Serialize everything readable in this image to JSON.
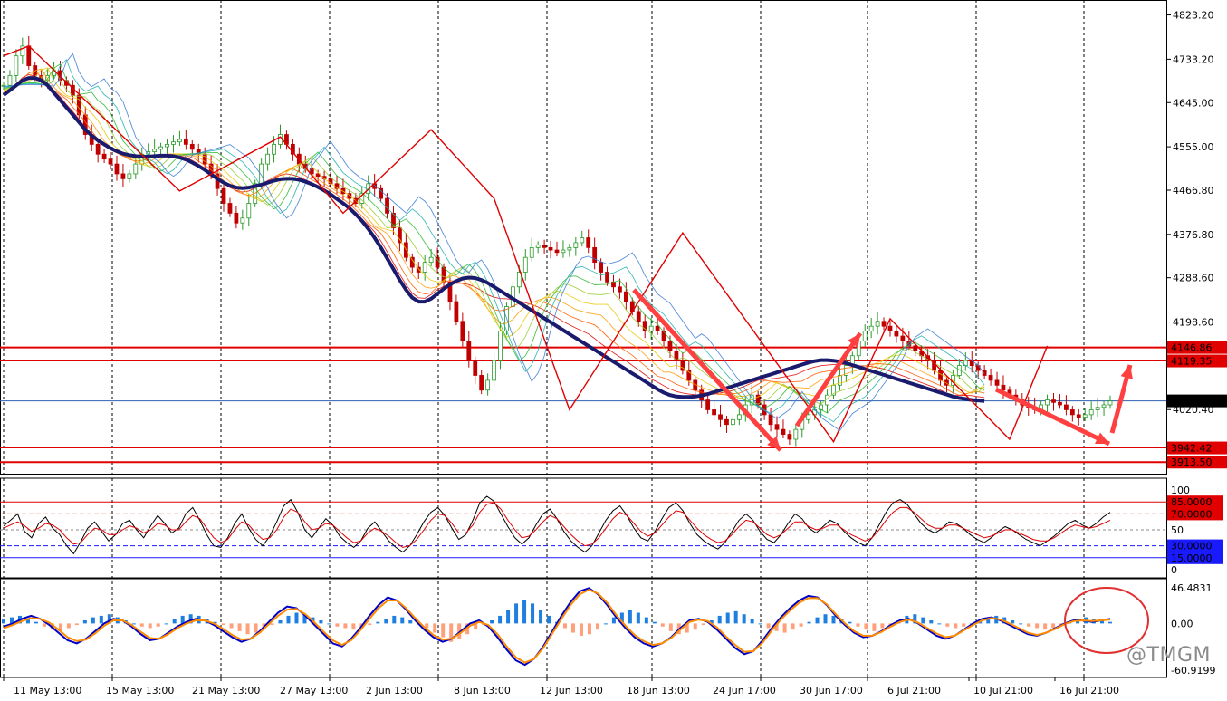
{
  "watermark": "@TMGM",
  "chart_data": [
    {
      "type": "candlestick",
      "panel": "price",
      "ylim": [
        3890,
        4850
      ],
      "ticks": [
        "4823.20",
        "4733.20",
        "4645.00",
        "4555.00",
        "4466.80",
        "4376.80",
        "4288.60",
        "4198.60",
        "4020.40"
      ],
      "tick_values": [
        4823.2,
        4733.2,
        4645.0,
        4555.0,
        4466.8,
        4376.8,
        4288.6,
        4198.6,
        4020.4
      ],
      "current_price": {
        "label": "4038.14",
        "value": 4038.14,
        "color": "#2f5fb0"
      },
      "levels": [
        {
          "label": "4146.86",
          "value": 4146.86,
          "color": "#e00000"
        },
        {
          "label": "4119.35",
          "value": 4119.35,
          "color": "#e00000"
        },
        {
          "label": "3942.42",
          "value": 3942.42,
          "color": "#e00000"
        },
        {
          "label": "3913.50",
          "value": 3913.5,
          "color": "#e00000"
        }
      ],
      "x_labels": [
        "11 May 13:00",
        "15 May 13:00",
        "21 May 13:00",
        "27 May 13:00",
        "2 Jun 13:00",
        "8 Jun 13:00",
        "12 Jun 13:00",
        "18 Jun 13:00",
        "24 Jun 17:00",
        "30 Jun 17:00",
        "6 Jul 21:00",
        "10 Jul 21:00",
        "16 Jul 21:00"
      ],
      "close_series": [
        4680,
        4700,
        4740,
        4760,
        4720,
        4700,
        4690,
        4700,
        4710,
        4690,
        4680,
        4660,
        4620,
        4580,
        4560,
        4540,
        4530,
        4520,
        4500,
        4490,
        4500,
        4520,
        4540,
        4545,
        4550,
        4555,
        4560,
        4565,
        4570,
        4560,
        4550,
        4540,
        4520,
        4500,
        4470,
        4440,
        4420,
        4400,
        4410,
        4440,
        4480,
        4520,
        4540,
        4560,
        4580,
        4560,
        4540,
        4520,
        4510,
        4500,
        4495,
        4490,
        4480,
        4470,
        4460,
        4450,
        4440,
        4460,
        4480,
        4470,
        4450,
        4420,
        4390,
        4360,
        4330,
        4310,
        4300,
        4320,
        4330,
        4310,
        4280,
        4240,
        4200,
        4160,
        4120,
        4090,
        4060,
        4080,
        4120,
        4180,
        4230,
        4270,
        4300,
        4330,
        4350,
        4355,
        4350,
        4345,
        4340,
        4345,
        4350,
        4360,
        4370,
        4350,
        4320,
        4300,
        4280,
        4270,
        4260,
        4240,
        4220,
        4200,
        4180,
        4190,
        4180,
        4160,
        4140,
        4120,
        4100,
        4080,
        4060,
        4040,
        4020,
        4010,
        4000,
        3990,
        4000,
        4010,
        4030,
        4050,
        4030,
        4010,
        3990,
        3980,
        3970,
        3960,
        3980,
        4000,
        4010,
        4020,
        4030,
        4050,
        4070,
        4090,
        4110,
        4130,
        4160,
        4180,
        4190,
        4200,
        4190,
        4180,
        4170,
        4160,
        4150,
        4140,
        4130,
        4120,
        4100,
        4080,
        4070,
        4090,
        4110,
        4120,
        4110,
        4100,
        4090,
        4080,
        4070,
        4060,
        4050,
        4040,
        4030,
        4025,
        4020,
        4030,
        4040,
        4035,
        4030,
        4020,
        4010,
        4005,
        4010,
        4020,
        4025,
        4030,
        4038
      ],
      "ma_series": [
        4660,
        4670,
        4680,
        4690,
        4695,
        4695,
        4690,
        4680,
        4665,
        4650,
        4635,
        4620,
        4605,
        4590,
        4578,
        4568,
        4560,
        4552,
        4546,
        4541,
        4538,
        4536,
        4535,
        4535,
        4536,
        4537,
        4537,
        4536,
        4533,
        4529,
        4523,
        4516,
        4508,
        4499,
        4490,
        4482,
        4476,
        4472,
        4471,
        4472,
        4475,
        4478,
        4482,
        4486,
        4489,
        4490,
        4490,
        4488,
        4484,
        4479,
        4473,
        4466,
        4458,
        4449,
        4440,
        4430,
        4418,
        4404,
        4388,
        4370,
        4350,
        4328,
        4306,
        4284,
        4264,
        4248,
        4240,
        4240,
        4246,
        4256,
        4266,
        4275,
        4282,
        4287,
        4289,
        4288,
        4284,
        4278,
        4270,
        4262,
        4254,
        4246,
        4238,
        4230,
        4222,
        4214,
        4206,
        4198,
        4190,
        4182,
        4174,
        4166,
        4158,
        4150,
        4142,
        4134,
        4126,
        4118,
        4110,
        4102,
        4094,
        4086,
        4078,
        4070,
        4062,
        4055,
        4050,
        4047,
        4046,
        4046,
        4047,
        4049,
        4052,
        4056,
        4060,
        4064,
        4068,
        4072,
        4076,
        4080,
        4084,
        4088,
        4092,
        4096,
        4100,
        4104,
        4108,
        4112,
        4116,
        4119,
        4121,
        4121,
        4120,
        4118,
        4115,
        4111,
        4107,
        4103,
        4099,
        4095,
        4091,
        4087,
        4083,
        4079,
        4075,
        4071,
        4067,
        4063,
        4059,
        4055,
        4051,
        4047,
        4044,
        4042,
        4040,
        4039,
        4038
      ]
    },
    {
      "type": "line",
      "panel": "stochastic",
      "ylim": [
        0,
        100
      ],
      "tick_labels": [
        "100",
        "50",
        "0"
      ],
      "levels": [
        {
          "label": "85.0000",
          "value": 85,
          "color": "#e00000"
        },
        {
          "label": "70.0000",
          "value": 70,
          "color": "#e00000"
        },
        {
          "label": "30.0000",
          "value": 30,
          "color": "#1a1aff"
        },
        {
          "label": "15.0000",
          "value": 15,
          "color": "#1a1aff"
        }
      ],
      "series": [
        {
          "color": "#000000",
          "values": [
            55,
            62,
            70,
            48,
            40,
            58,
            66,
            52,
            44,
            30,
            20,
            35,
            52,
            60,
            48,
            36,
            44,
            58,
            62,
            50,
            40,
            55,
            68,
            58,
            46,
            52,
            70,
            78,
            62,
            44,
            30,
            28,
            40,
            58,
            70,
            52,
            38,
            30,
            42,
            60,
            80,
            88,
            72,
            50,
            40,
            52,
            64,
            56,
            42,
            34,
            28,
            36,
            52,
            60,
            48,
            36,
            28,
            22,
            30,
            44,
            60,
            72,
            78,
            68,
            52,
            38,
            44,
            62,
            84,
            92,
            86,
            70,
            54,
            40,
            32,
            40,
            56,
            70,
            76,
            64,
            48,
            36,
            28,
            22,
            30,
            46,
            62,
            74,
            80,
            68,
            52,
            40,
            36,
            48,
            64,
            78,
            84,
            74,
            58,
            44,
            36,
            30,
            26,
            34,
            48,
            62,
            70,
            62,
            48,
            38,
            34,
            44,
            58,
            70,
            64,
            52,
            46,
            54,
            62,
            58,
            48,
            40,
            34,
            30,
            40,
            56,
            72,
            84,
            88,
            82,
            70,
            58,
            50,
            46,
            52,
            60,
            58,
            52,
            44,
            38,
            34,
            40,
            48,
            54,
            50,
            44,
            38,
            34,
            30,
            36,
            42,
            50,
            58,
            62,
            56,
            52,
            58,
            66,
            72
          ]
        },
        {
          "color": "#e00000",
          "values": [
            52,
            56,
            60,
            55,
            48,
            52,
            58,
            56,
            50,
            40,
            32,
            34,
            44,
            52,
            50,
            44,
            44,
            50,
            55,
            52,
            46,
            50,
            58,
            56,
            50,
            50,
            60,
            68,
            64,
            52,
            40,
            34,
            38,
            50,
            60,
            56,
            46,
            38,
            40,
            50,
            66,
            76,
            72,
            60,
            50,
            52,
            58,
            56,
            48,
            40,
            34,
            36,
            46,
            52,
            48,
            42,
            34,
            28,
            30,
            38,
            50,
            62,
            70,
            68,
            58,
            46,
            46,
            56,
            72,
            82,
            84,
            76,
            62,
            50,
            40,
            42,
            50,
            60,
            68,
            64,
            54,
            44,
            36,
            30,
            32,
            40,
            52,
            64,
            72,
            68,
            58,
            48,
            42,
            46,
            56,
            66,
            74,
            72,
            62,
            52,
            44,
            38,
            34,
            36,
            44,
            54,
            62,
            60,
            52,
            44,
            40,
            44,
            52,
            60,
            60,
            54,
            50,
            52,
            56,
            56,
            50,
            44,
            40,
            36,
            40,
            50,
            62,
            72,
            78,
            78,
            72,
            64,
            56,
            52,
            52,
            56,
            56,
            52,
            48,
            44,
            40,
            42,
            46,
            50,
            50,
            46,
            42,
            38,
            36,
            36,
            40,
            46,
            52,
            56,
            54,
            52,
            54,
            58,
            62
          ]
        }
      ]
    },
    {
      "type": "bar+line",
      "panel": "macd",
      "ylim": [
        -60.9199,
        46.4831
      ],
      "tick_labels": [
        "46.4831",
        "0.00",
        "-60.9199"
      ],
      "histogram": [
        5,
        8,
        10,
        6,
        2,
        -4,
        -8,
        -10,
        -6,
        -2,
        4,
        8,
        10,
        12,
        8,
        4,
        0,
        -4,
        -6,
        -4,
        0,
        6,
        10,
        12,
        10,
        6,
        2,
        -2,
        -6,
        -10,
        -14,
        -12,
        -8,
        -2,
        4,
        10,
        14,
        12,
        8,
        4,
        0,
        -4,
        -6,
        -8,
        -6,
        -2,
        2,
        6,
        10,
        8,
        4,
        0,
        -6,
        -12,
        -18,
        -24,
        -20,
        -14,
        -8,
        -2,
        4,
        10,
        18,
        26,
        30,
        26,
        18,
        10,
        2,
        -6,
        -12,
        -16,
        -14,
        -8,
        0,
        8,
        14,
        18,
        14,
        8,
        2,
        -4,
        -10,
        -14,
        -12,
        -8,
        -2,
        4,
        10,
        14,
        16,
        12,
        6,
        0,
        -6,
        -10,
        -12,
        -8,
        -4,
        2,
        8,
        12,
        10,
        6,
        2,
        -4,
        -8,
        -10,
        -6,
        -2,
        4,
        10,
        12,
        8,
        4,
        0,
        -4,
        -6,
        -4,
        0,
        4,
        8,
        10,
        8,
        4,
        0,
        -4,
        -6,
        -8,
        -6,
        -2,
        2,
        6,
        8,
        6,
        4,
        2
      ],
      "series": [
        {
          "color": "#0000c8",
          "values": [
            -4,
            0,
            6,
            10,
            6,
            -2,
            -12,
            -22,
            -26,
            -20,
            -10,
            0,
            6,
            4,
            -4,
            -14,
            -22,
            -20,
            -12,
            -4,
            2,
            6,
            4,
            -2,
            -10,
            -18,
            -24,
            -20,
            -10,
            2,
            14,
            22,
            20,
            10,
            -2,
            -14,
            -26,
            -30,
            -20,
            -6,
            10,
            24,
            34,
            30,
            18,
            4,
            -8,
            -18,
            -24,
            -20,
            -10,
            0,
            4,
            -4,
            -18,
            -34,
            -48,
            -54,
            -46,
            -30,
            -10,
            10,
            28,
            42,
            46,
            38,
            24,
            8,
            -6,
            -18,
            -26,
            -30,
            -26,
            -18,
            -6,
            4,
            6,
            2,
            -8,
            -20,
            -32,
            -40,
            -36,
            -22,
            -6,
            8,
            20,
            30,
            36,
            34,
            24,
            10,
            -2,
            -12,
            -18,
            -16,
            -10,
            -2,
            4,
            6,
            0,
            -8,
            -16,
            -20,
            -16,
            -8,
            0,
            6,
            8,
            4,
            -2,
            -8,
            -14,
            -16,
            -12,
            -6,
            0,
            4,
            4,
            2,
            4,
            6
          ]
        },
        {
          "color": "#ff8c00",
          "values": [
            -6,
            -2,
            3,
            7,
            6,
            1,
            -8,
            -18,
            -23,
            -21,
            -13,
            -3,
            4,
            4,
            -2,
            -11,
            -19,
            -20,
            -14,
            -6,
            0,
            4,
            4,
            0,
            -7,
            -15,
            -21,
            -20,
            -12,
            -1,
            10,
            18,
            19,
            12,
            1,
            -11,
            -22,
            -28,
            -22,
            -9,
            6,
            20,
            30,
            30,
            20,
            7,
            -5,
            -15,
            -21,
            -20,
            -12,
            -3,
            2,
            -2,
            -14,
            -30,
            -44,
            -51,
            -46,
            -32,
            -13,
            6,
            24,
            38,
            44,
            39,
            27,
            11,
            -3,
            -15,
            -23,
            -28,
            -26,
            -19,
            -8,
            2,
            5,
            3,
            -5,
            -17,
            -28,
            -37,
            -36,
            -25,
            -9,
            5,
            17,
            27,
            33,
            33,
            25,
            12,
            0,
            -10,
            -16,
            -16,
            -11,
            -4,
            2,
            5,
            1,
            -6,
            -13,
            -18,
            -16,
            -9,
            -2,
            4,
            7,
            5,
            0,
            -6,
            -12,
            -15,
            -12,
            -7,
            -1,
            3,
            4,
            3,
            4,
            5
          ]
        }
      ]
    }
  ]
}
